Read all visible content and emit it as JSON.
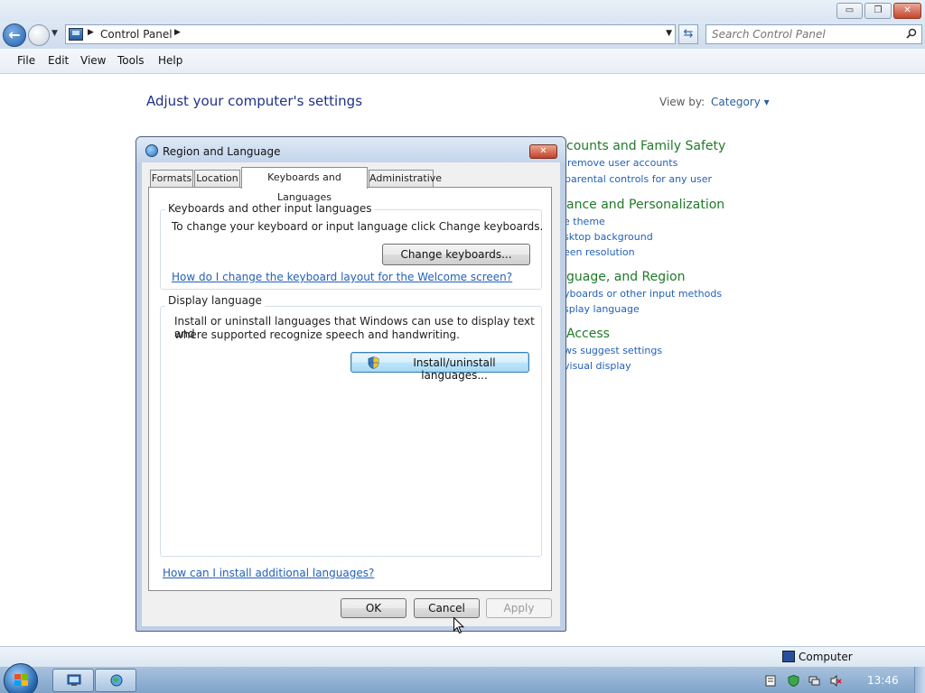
{
  "window": {
    "controls": {
      "minimize": "▭",
      "maximize": "❐",
      "close": "✕"
    }
  },
  "addressbar": {
    "path": "Control Panel",
    "search_placeholder": "Search Control Panel"
  },
  "menu": [
    "File",
    "Edit",
    "View",
    "Tools",
    "Help"
  ],
  "content": {
    "heading": "Adjust your computer's settings",
    "view_by_label": "View by:",
    "view_by_value": "Category ▾",
    "categories": [
      {
        "title": "counts and Family Safety",
        "links": [
          "remove user accounts",
          "parental controls for any user"
        ]
      },
      {
        "title": "ance and Personalization",
        "links": [
          "e theme",
          "sktop background",
          "een resolution"
        ]
      },
      {
        "title": "guage, and Region",
        "links": [
          "yboards or other input methods",
          "splay language"
        ]
      },
      {
        "title": "Access",
        "links": [
          "ws suggest settings",
          "visual display"
        ]
      }
    ]
  },
  "dialog": {
    "title": "Region and Language",
    "close": "✕",
    "tabs": [
      "Formats",
      "Location",
      "Keyboards and Languages",
      "Administrative"
    ],
    "active_tab": "Keyboards and Languages",
    "keyboards_group": {
      "title": "Keyboards and other input languages",
      "description": "To change your keyboard or input language click Change keyboards.",
      "button": "Change keyboards...",
      "link": "How do I change the keyboard layout for the Welcome screen?"
    },
    "display_group": {
      "title": "Display language",
      "description_line1": "Install or uninstall languages that Windows can use to display text and",
      "description_line2": "where supported recognize speech and handwriting.",
      "button": "Install/uninstall languages..."
    },
    "bottom_link": "How can I install additional languages?",
    "buttons": {
      "ok": "OK",
      "cancel": "Cancel",
      "apply": "Apply"
    }
  },
  "statusbar": {
    "text": "Computer"
  },
  "taskbar": {
    "clock": "13:46"
  }
}
